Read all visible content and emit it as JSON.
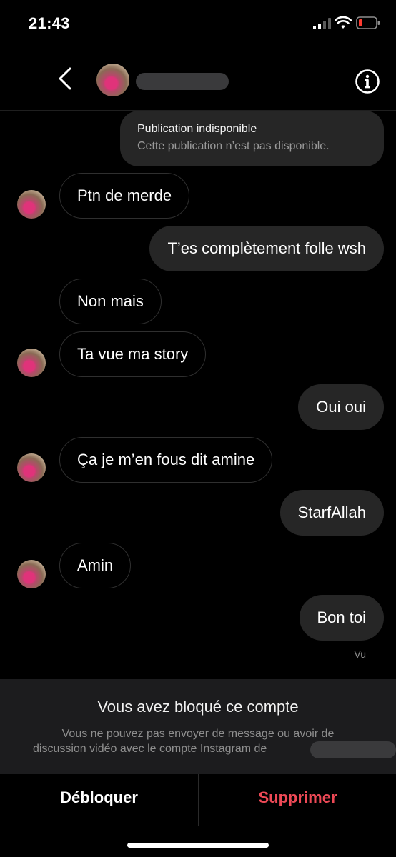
{
  "status_bar": {
    "time": "21:43",
    "signal_icon": "cellular-signal-icon",
    "wifi_icon": "wifi-icon",
    "battery_icon": "battery-low-icon",
    "battery_color": "#ff3b30"
  },
  "header": {
    "back_icon": "chevron-left-icon",
    "info_icon": "info-circle-icon"
  },
  "messages": {
    "unavailable_post": {
      "title": "Publication indisponible",
      "subtitle": "Cette publication n’est pas disponible."
    },
    "items": [
      {
        "direction": "in",
        "text": "Ptn de merde"
      },
      {
        "direction": "out",
        "text": "T’es complètement folle wsh"
      },
      {
        "direction": "in",
        "text": "Non mais"
      },
      {
        "direction": "in",
        "text": "Ta vue ma story"
      },
      {
        "direction": "out",
        "text": "Oui oui"
      },
      {
        "direction": "in",
        "text": "Ça je m’en fous dit amine"
      },
      {
        "direction": "out",
        "text": "StarfAllah"
      },
      {
        "direction": "in",
        "text": "Amin"
      },
      {
        "direction": "out",
        "text": "Bon toi"
      }
    ],
    "seen": "Vu"
  },
  "blocked": {
    "title": "Vous avez bloqué ce compte",
    "description_line1": "Vous ne pouvez pas envoyer de message ou avoir de",
    "description_line2": "discussion vidéo avec le compte Instagram de"
  },
  "actions": {
    "unblock": "Débloquer",
    "delete": "Supprimer",
    "delete_color": "#ed4956"
  }
}
